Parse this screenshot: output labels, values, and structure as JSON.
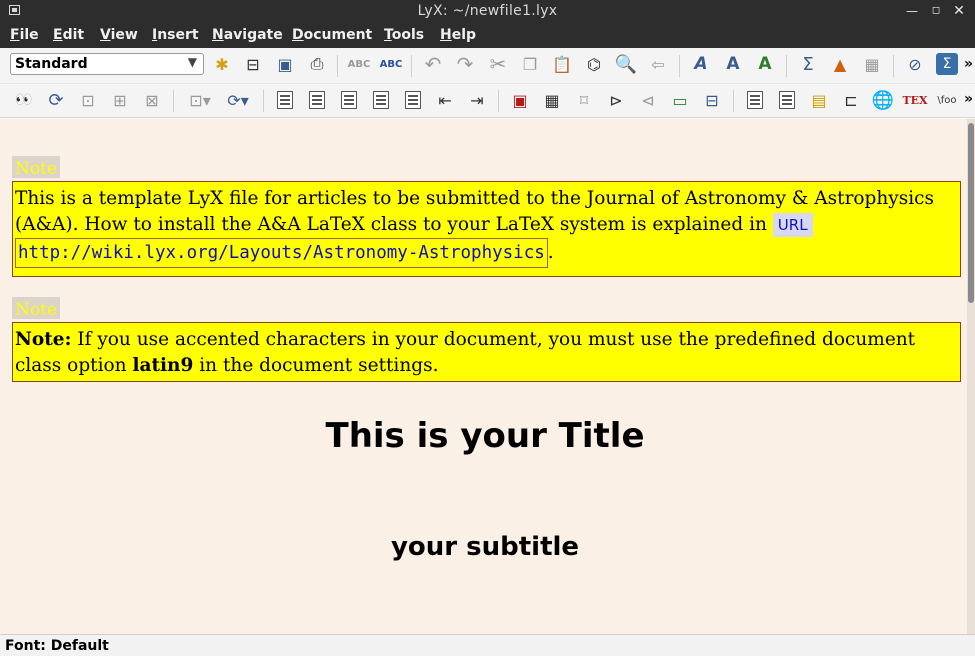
{
  "window": {
    "title": "LyX: ~/newfile1.lyx"
  },
  "menubar": {
    "items": [
      "File",
      "Edit",
      "View",
      "Insert",
      "Navigate",
      "Document",
      "Tools",
      "Help"
    ]
  },
  "toolbar": {
    "paragraph_style": "Standard",
    "overflow_glyph": "»"
  },
  "document": {
    "note1": {
      "label": "Note",
      "text_before": "This is a template LyX file for articles to be submitted to the Journal of Astronomy & Astrophysics (A&A). How to install the A&A LaTeX class to your LaTeX system is explained in",
      "url_label": "URL",
      "url": "http://wiki.lyx.org/Layouts/Astronomy-Astrophysics",
      "text_after": "."
    },
    "note2": {
      "label": "Note",
      "bold_lead": "Note:",
      "text_mid": " If you use accented characters in your document, you must use the predefined document class option ",
      "bold_option": "latin9",
      "text_end": " in the document settings."
    },
    "title": "This is your Title",
    "subtitle": "your subtitle"
  },
  "statusbar": {
    "text": "Font: Default"
  },
  "colors": {
    "chrome": "#2d2d2d",
    "note_background": "#ffff00",
    "page_background": "#faf0e6",
    "url_text": "#1010b0"
  }
}
